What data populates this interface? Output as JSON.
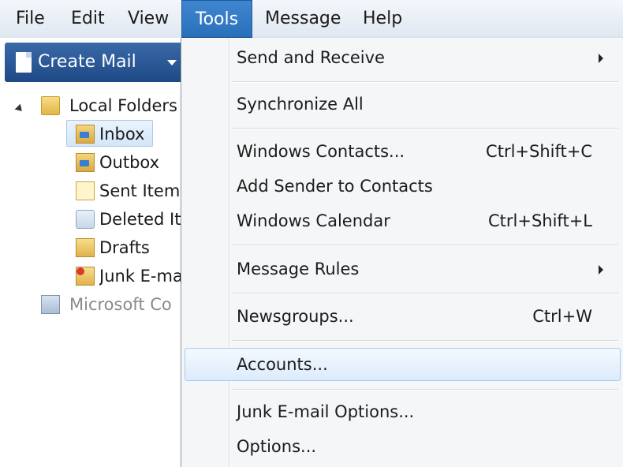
{
  "menubar": {
    "items": [
      {
        "label": "File"
      },
      {
        "label": "Edit"
      },
      {
        "label": "View"
      },
      {
        "label": "Tools"
      },
      {
        "label": "Message"
      },
      {
        "label": "Help"
      }
    ],
    "active": "Tools"
  },
  "toolbar": {
    "create_mail_label": "Create Mail",
    "create_mail_icon": "new-mail-icon"
  },
  "tree": {
    "root": {
      "label": "Local Folders",
      "icon": "folder-icon"
    },
    "folders": [
      {
        "label": "Inbox",
        "icon": "inbox-icon"
      },
      {
        "label": "Outbox",
        "icon": "outbox-icon"
      },
      {
        "label": "Sent Item",
        "icon": "sent-items-icon"
      },
      {
        "label": "Deleted It",
        "icon": "deleted-items-icon"
      },
      {
        "label": "Drafts",
        "icon": "drafts-icon"
      },
      {
        "label": "Junk E-ma",
        "icon": "junk-mail-icon"
      }
    ],
    "other": {
      "label": "Microsoft Co",
      "icon": "communities-icon"
    },
    "selected": "Inbox"
  },
  "tools_menu": {
    "items": [
      {
        "label": "Send and Receive",
        "shortcut": "",
        "submenu": true
      },
      {
        "label": "Synchronize All",
        "shortcut": "",
        "submenu": false
      },
      {
        "label": "Windows Contacts...",
        "shortcut": "Ctrl+Shift+C",
        "submenu": false
      },
      {
        "label": "Add Sender to Contacts",
        "shortcut": "",
        "submenu": false
      },
      {
        "label": "Windows Calendar",
        "shortcut": "Ctrl+Shift+L",
        "submenu": false
      },
      {
        "label": "Message Rules",
        "shortcut": "",
        "submenu": true
      },
      {
        "label": "Newsgroups...",
        "shortcut": "Ctrl+W",
        "submenu": false
      },
      {
        "label": "Accounts...",
        "shortcut": "",
        "submenu": false
      },
      {
        "label": "Junk E-mail Options...",
        "shortcut": "",
        "submenu": false
      },
      {
        "label": "Options...",
        "shortcut": "",
        "submenu": false
      }
    ],
    "highlighted": "Accounts..."
  }
}
